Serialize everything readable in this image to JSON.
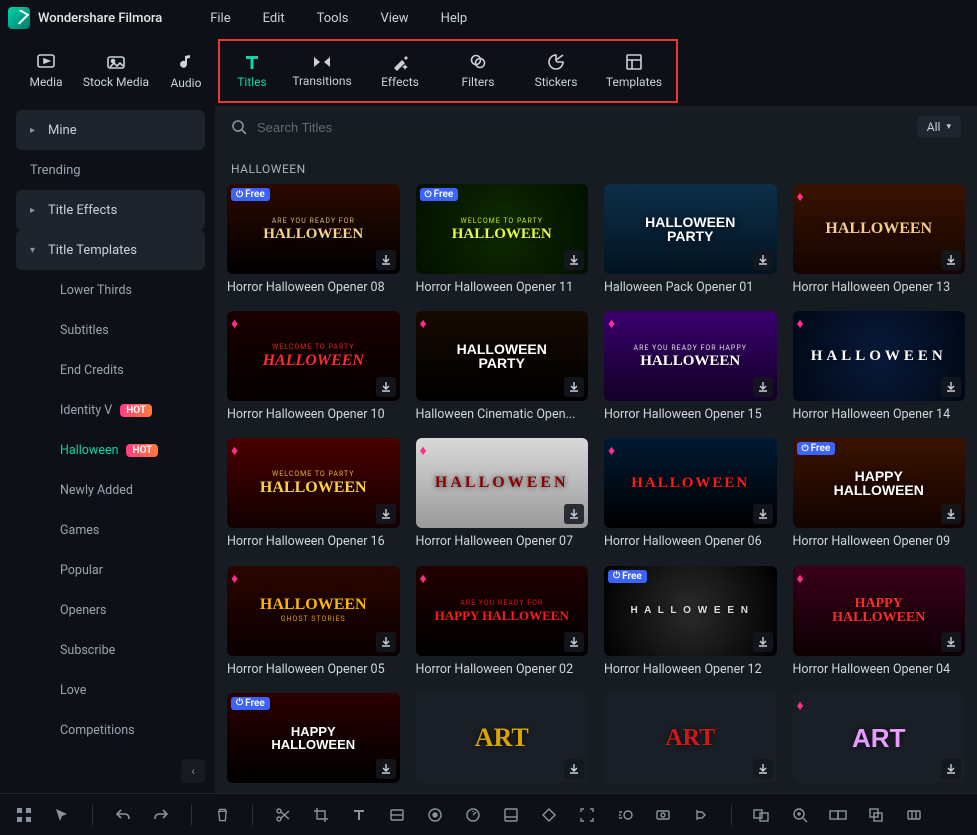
{
  "brand": "Wondershare Filmora",
  "menu": [
    "File",
    "Edit",
    "Tools",
    "View",
    "Help"
  ],
  "tabs": [
    {
      "label": "Media"
    },
    {
      "label": "Stock Media"
    },
    {
      "label": "Audio"
    },
    {
      "label": "Titles",
      "active": true
    },
    {
      "label": "Transitions"
    },
    {
      "label": "Effects"
    },
    {
      "label": "Filters"
    },
    {
      "label": "Stickers"
    },
    {
      "label": "Templates"
    }
  ],
  "search": {
    "placeholder": "Search Titles"
  },
  "filter_all": "All",
  "sidebar": {
    "items": [
      {
        "label": "Mine",
        "type": "cat",
        "chev": "▸"
      },
      {
        "label": "Trending",
        "type": "plain"
      },
      {
        "label": "Title Effects",
        "type": "cat",
        "chev": "▸"
      },
      {
        "label": "Title Templates",
        "type": "cat",
        "chev": "▾"
      },
      {
        "label": "Lower Thirds",
        "type": "sub"
      },
      {
        "label": "Subtitles",
        "type": "sub"
      },
      {
        "label": "End Credits",
        "type": "sub"
      },
      {
        "label": "Identity V",
        "type": "sub",
        "hot": "HOT"
      },
      {
        "label": "Halloween",
        "type": "sub",
        "hot": "HOT",
        "active": true
      },
      {
        "label": "Newly Added",
        "type": "sub"
      },
      {
        "label": "Games",
        "type": "sub"
      },
      {
        "label": "Popular",
        "type": "sub"
      },
      {
        "label": "Openers",
        "type": "sub"
      },
      {
        "label": "Subscribe",
        "type": "sub"
      },
      {
        "label": "Love",
        "type": "sub"
      },
      {
        "label": "Competitions",
        "type": "sub"
      }
    ]
  },
  "section_title": "HALLOWEEN",
  "cards": [
    {
      "title": "Horror Halloween Opener 08",
      "badge": "free",
      "th": {
        "bg": "linear-gradient(#2b0900,#000)",
        "main": "HALLOWEEN",
        "sub": "ARE YOU READY FOR",
        "mainColor": "#f6d38a",
        "mainSize": "15px",
        "font": "serif"
      }
    },
    {
      "title": "Horror Halloween Opener 11",
      "badge": "free",
      "th": {
        "bg": "radial-gradient(circle,#0f2a00,#011000)",
        "main": "HALLOWEEN",
        "sub": "WELCOME TO PARTY",
        "mainColor": "#e7ff3b",
        "mainSize": "15px",
        "font": "cursive"
      }
    },
    {
      "title": "Halloween Pack Opener 01",
      "badge": "",
      "th": {
        "bg": "linear-gradient(#0d2f4a,#02131f)",
        "main": "HALLOWEEN\nPARTY",
        "sub": "",
        "mainColor": "#fff",
        "mainSize": "14px",
        "font": "sans-serif",
        "weight": "900"
      }
    },
    {
      "title": "Horror Halloween Opener 13",
      "badge": "gem",
      "th": {
        "bg": "linear-gradient(#3a1300,#140400)",
        "main": "HALLOWEEN",
        "sub": "",
        "mainColor": "#f6cc88",
        "mainSize": "16px",
        "font": "serif"
      }
    },
    {
      "title": "Horror Halloween Opener 10",
      "badge": "gem",
      "th": {
        "bg": "linear-gradient(#1a0000,#050000)",
        "main": "HALLOWEEN",
        "sub": "WELCOME TO PARTY",
        "mainColor": "#ff2a2a",
        "mainSize": "16px",
        "font": "cursive",
        "italic": true
      }
    },
    {
      "title": "Halloween Cinematic Open...",
      "badge": "gem",
      "th": {
        "bg": "linear-gradient(#160a00,#000)",
        "main": "HALLOWEEN\nPARTY",
        "sub": "",
        "mainColor": "#fff",
        "mainSize": "14px",
        "font": "sans-serif",
        "weight": "900"
      }
    },
    {
      "title": "Horror Halloween Opener 15",
      "badge": "gem",
      "th": {
        "bg": "linear-gradient(#3b006f,#120026)",
        "main": "HALLOWEEN",
        "sub": "ARE YOU READY FOR HAPPY",
        "mainColor": "#fff",
        "mainSize": "15px",
        "font": "cursive"
      }
    },
    {
      "title": "Horror Halloween Opener 14",
      "badge": "gem",
      "th": {
        "bg": "radial-gradient(circle,#0a1a3d,#000814)",
        "main": "HALLOWEEN",
        "sub": "",
        "mainColor": "#fff",
        "mainSize": "15px",
        "font": "serif",
        "spacing": "4px"
      }
    },
    {
      "title": "Horror Halloween Opener 16",
      "badge": "gem",
      "th": {
        "bg": "linear-gradient(#4a0000,#120000)",
        "main": "HALLOWEEN",
        "sub": "WELCOME TO PARTY",
        "mainColor": "#ffd23d",
        "mainSize": "16px",
        "font": "cursive"
      }
    },
    {
      "title": "Horror Halloween Opener 07",
      "badge": "gem",
      "th": {
        "bg": "linear-gradient(#d9d9d9,#9a9a9a)",
        "main": "HALLOWEEN",
        "sub": "",
        "mainColor": "#8b0000",
        "mainSize": "16px",
        "font": "serif",
        "spacing": "3px"
      }
    },
    {
      "title": "Horror Halloween Opener 06",
      "badge": "gem",
      "th": {
        "bg": "linear-gradient(#001a33,#000)",
        "main": "HALLOWEEN",
        "sub": "",
        "mainColor": "#ff1a1a",
        "mainSize": "15px",
        "font": "serif",
        "spacing": "2px"
      }
    },
    {
      "title": "Horror Halloween Opener 09",
      "badge": "free",
      "th": {
        "bg": "linear-gradient(#3a1300,#120300)",
        "main": "HAPPY\nHALLOWEEN",
        "sub": "",
        "mainColor": "#fff",
        "mainSize": "14px",
        "font": "sans-serif",
        "weight": "900"
      }
    },
    {
      "title": "Horror Halloween Opener 05",
      "badge": "gem",
      "th": {
        "bg": "linear-gradient(#2a0500,#0a0000)",
        "main": "HALLOWEEN",
        "sub": "GHOST STORIES",
        "mainColor": "#ffb700",
        "mainSize": "16px",
        "font": "cursive",
        "subBelow": true
      }
    },
    {
      "title": "Horror Halloween Opener 02",
      "badge": "gem",
      "th": {
        "bg": "linear-gradient(#200,#000)",
        "main": "HAPPY HALLOWEEN",
        "sub": "ARE YOU READY FOR",
        "mainColor": "#ff1a1a",
        "mainSize": "13px",
        "font": "cursive"
      }
    },
    {
      "title": "Horror Halloween Opener 12",
      "badge": "free",
      "th": {
        "bg": "radial-gradient(circle,#2b2b2b,#000)",
        "main": "H A L L O W E E N",
        "sub": "",
        "mainColor": "#ddd",
        "mainSize": "10px",
        "font": "sans-serif",
        "spacing": "2px"
      }
    },
    {
      "title": "Horror Halloween Opener 04",
      "badge": "gem",
      "th": {
        "bg": "linear-gradient(#3a0018,#0d0005)",
        "main": "HAPPY\nHALLOWEEN",
        "sub": "",
        "mainColor": "#ff2a2a",
        "mainSize": "14px",
        "font": "cursive"
      }
    },
    {
      "title": "",
      "badge": "free",
      "th": {
        "bg": "linear-gradient(#2b0000,#000)",
        "main": "HAPPY\nHALLOWEEN",
        "sub": "",
        "mainColor": "#fff",
        "mainSize": "13px",
        "font": "sans-serif",
        "weight": "900"
      }
    },
    {
      "title": "",
      "badge": "",
      "th": {
        "bg": "#1a1f27",
        "main": "ART",
        "sub": "",
        "mainColor": "#d9a300",
        "mainSize": "26px",
        "font": "serif",
        "weight": "900"
      }
    },
    {
      "title": "",
      "badge": "",
      "th": {
        "bg": "#1a1f27",
        "main": "ART",
        "sub": "",
        "mainColor": "#d01818",
        "mainSize": "24px",
        "font": "serif",
        "weight": "900"
      }
    },
    {
      "title": "",
      "badge": "gem",
      "th": {
        "bg": "#1a1f27",
        "main": "ART",
        "sub": "",
        "mainColor": "#e79cff",
        "mainSize": "26px",
        "font": "sans-serif",
        "weight": "900"
      }
    }
  ]
}
